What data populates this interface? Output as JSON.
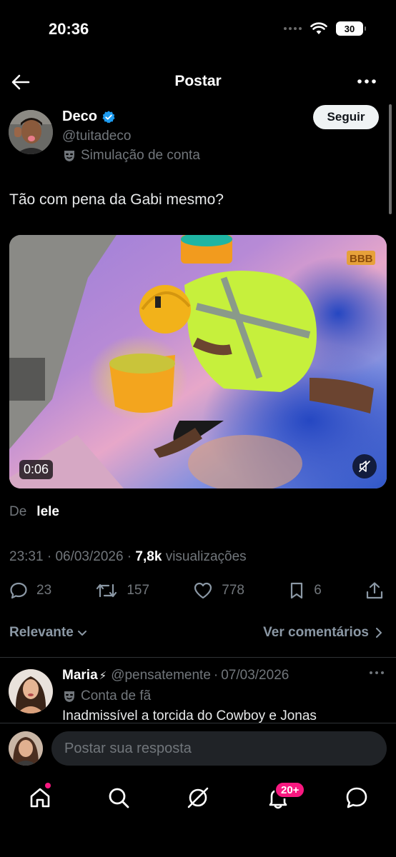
{
  "status_bar": {
    "time": "20:36",
    "battery": "30"
  },
  "header": {
    "title": "Postar"
  },
  "post": {
    "author": {
      "name": "Deco",
      "handle": "@tuitadeco",
      "label": "Simulação de conta"
    },
    "follow_label": "Seguir",
    "text": "Tão com pena da Gabi mesmo?",
    "media": {
      "duration": "0:06",
      "watermark": "BBB"
    },
    "from": {
      "prefix": "De",
      "user": "lele"
    },
    "meta": {
      "time": "23:31",
      "date": "06/03/2026",
      "views_count": "7,8k",
      "views_label": "visualizações"
    },
    "stats": {
      "replies": "23",
      "reposts": "157",
      "likes": "778",
      "bookmarks": "6"
    }
  },
  "sort": {
    "label": "Relevante",
    "comments_link": "Ver comentários"
  },
  "reply": {
    "name": "Maria",
    "handle": "@pensatemente",
    "date": "07/03/2026",
    "label": "Conta de fã",
    "text": "Inadmissível a torcida do Cowboy e Jonas"
  },
  "composer": {
    "placeholder": "Postar sua resposta"
  },
  "tabbar": {
    "notifications_badge": "20+"
  },
  "colors": {
    "accent": "#1d9bf0",
    "badge": "#f91880",
    "background": "#000000"
  }
}
